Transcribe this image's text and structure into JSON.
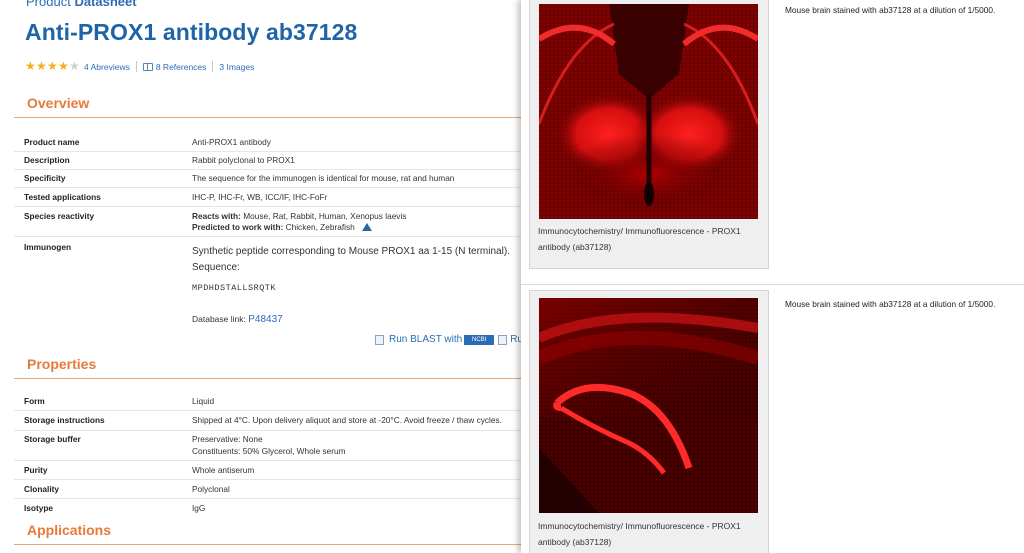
{
  "breadcrumb": {
    "prefix": "Product",
    "label": "Datasheet"
  },
  "product": {
    "title": "Anti-PROX1 antibody ab37128",
    "rating": 4,
    "abreviews": "4 Abreviews",
    "references": "8 References",
    "images": "3 Images"
  },
  "overview": {
    "heading": "Overview",
    "rows": [
      {
        "label": "Product name",
        "value": "Anti-PROX1 antibody"
      },
      {
        "label": "Description",
        "value": "Rabbit polyclonal to PROX1"
      },
      {
        "label": "Specificity",
        "value": "The sequence for the immunogen is identical for mouse, rat and human"
      },
      {
        "label": "Tested applications",
        "value": "IHC-P, IHC-Fr, WB, ICC/IF, IHC-FoFr"
      },
      {
        "label": "Species reactivity",
        "reacts_label": "Reacts with:",
        "reacts_value": "Mouse, Rat, Rabbit, Human, Xenopus laevis",
        "predicted_label": "Predicted to work with:",
        "predicted_value": "Chicken, Zebrafish"
      },
      {
        "label": "Immunogen",
        "line1": "Synthetic peptide corresponding to Mouse PROX1 aa 1-15 (N terminal).",
        "line2": "Sequence:",
        "sequence": "MPDHDSTALLSRQTK",
        "db_label": "Database link:",
        "db_value": "P48437"
      }
    ],
    "blast_label": "Run BLAST with",
    "ncbi": "NCBI",
    "blast_tail": "Ru"
  },
  "properties": {
    "heading": "Properties",
    "rows": [
      {
        "label": "Form",
        "value": "Liquid"
      },
      {
        "label": "Storage instructions",
        "value": "Shipped at 4°C. Upon delivery aliquot and store at -20°C. Avoid freeze / thaw cycles."
      },
      {
        "label": "Storage buffer",
        "value": "Preservative: None",
        "value2": "Constituents: 50% Glycerol, Whole serum"
      },
      {
        "label": "Purity",
        "value": "Whole antiserum"
      },
      {
        "label": "Clonality",
        "value": "Polyclonal"
      },
      {
        "label": "Isotype",
        "value": "IgG"
      }
    ]
  },
  "applications": {
    "heading": "Applications"
  },
  "image_panel": {
    "images": [
      {
        "caption": "Immunocytochemistry/ Immunofluorescence - PROX1 antibody (ab37128)",
        "legend": "Mouse brain stained with ab37128 at a dilution of 1/5000."
      },
      {
        "caption": "Immunocytochemistry/ Immunofluorescence - PROX1 antibody (ab37128)",
        "legend": "Mouse brain stained with ab37128 at a dilution of 1/5000."
      }
    ]
  },
  "colors": {
    "link": "#2a6db5",
    "title": "#1f64a8",
    "section": "#e57a3a",
    "star": "#f2b01e",
    "stain": "#ff1a1a"
  }
}
